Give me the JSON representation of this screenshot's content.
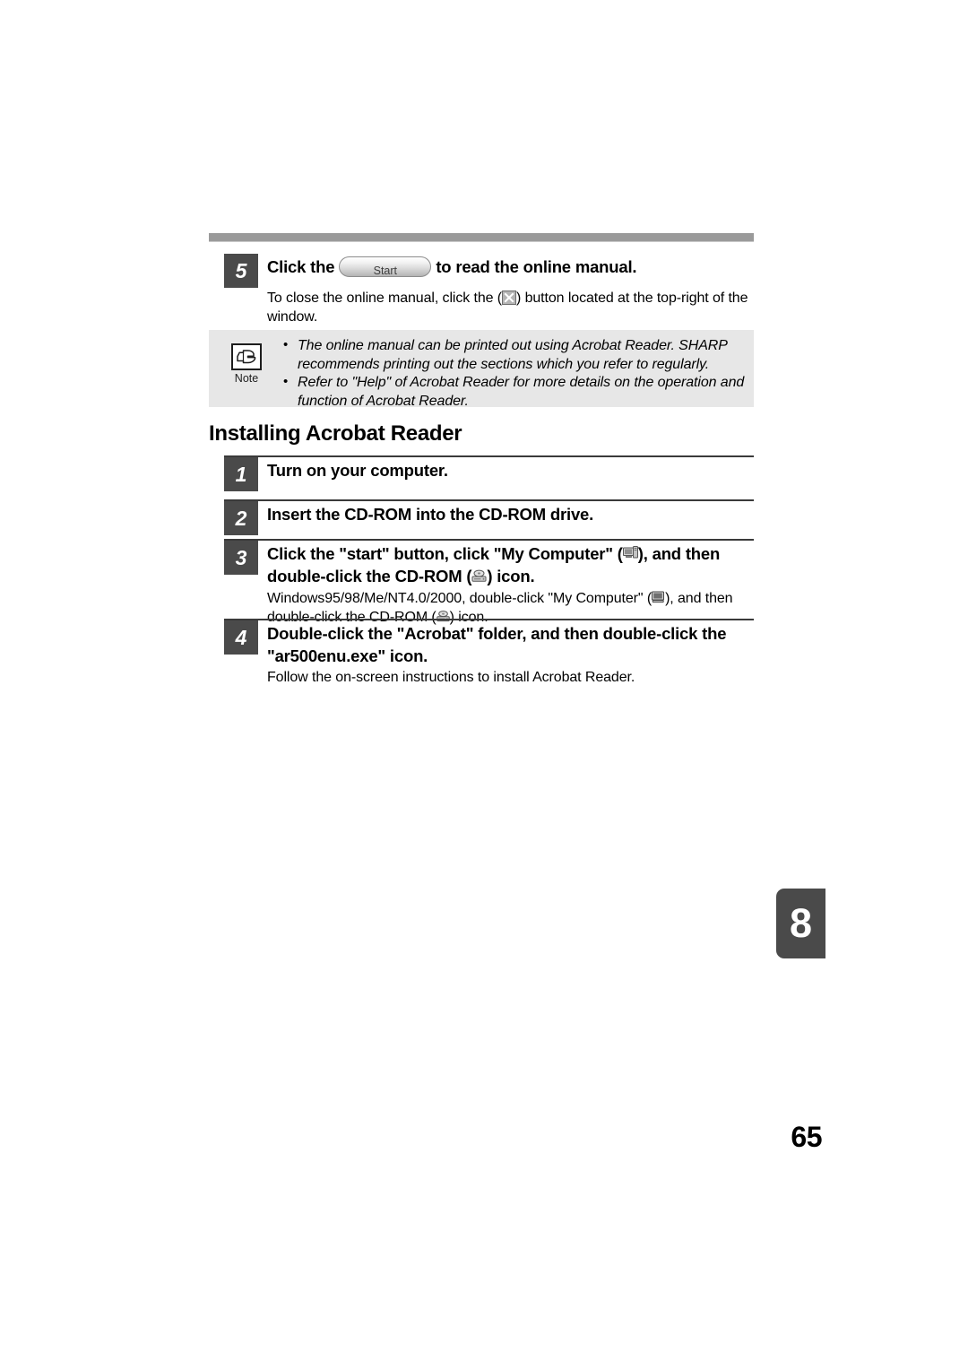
{
  "document": {
    "page_number": "65",
    "chapter_tab": "8"
  },
  "top_step": {
    "number": "5",
    "title_before": "Click the",
    "button_label": "Start",
    "title_after": "to read the online manual.",
    "body_before": "To close the online manual, click the (",
    "body_icon": "close-button-icon",
    "body_after": ") button located at the top-right of the window."
  },
  "note": {
    "icon": "pointing-hand-icon",
    "label": "Note",
    "items": [
      "The online manual can be printed out using Acrobat Reader. SHARP recommends printing out the sections which you refer to regularly.",
      "Refer to \"Help\" of Acrobat Reader for more details on the operation and function of Acrobat Reader."
    ]
  },
  "section": {
    "heading": "Installing Acrobat Reader",
    "steps": [
      {
        "number": "1",
        "title": "Turn on your computer.",
        "body": ""
      },
      {
        "number": "2",
        "title": "Insert the CD-ROM into the CD-ROM drive.",
        "body": ""
      },
      {
        "number": "3",
        "title_part1": "Click the \"start\" button, click \"My Computer\" (",
        "title_icon1": "my-computer-icon",
        "title_part2": "), and then double-click the CD-ROM (",
        "title_icon2": "cd-rom-icon",
        "title_part3": ") icon.",
        "body_part1": "Windows95/98/Me/NT4.0/2000, double-click \"My Computer\" (",
        "body_icon1": "my-computer-icon",
        "body_part2": "), and then double-click the CD-ROM (",
        "body_icon2": "cd-rom-icon",
        "body_part3": ") icon."
      },
      {
        "number": "4",
        "title": "Double-click the \"Acrobat\" folder, and then double-click the \"ar500enu.exe\" icon.",
        "body": "Follow the on-screen instructions to install Acrobat Reader."
      }
    ]
  },
  "colors": {
    "step_box": "#4a4a4a",
    "note_background": "#e7e7e7",
    "top_bar": "#9a9a9a",
    "rule": "#3a3a3a"
  }
}
